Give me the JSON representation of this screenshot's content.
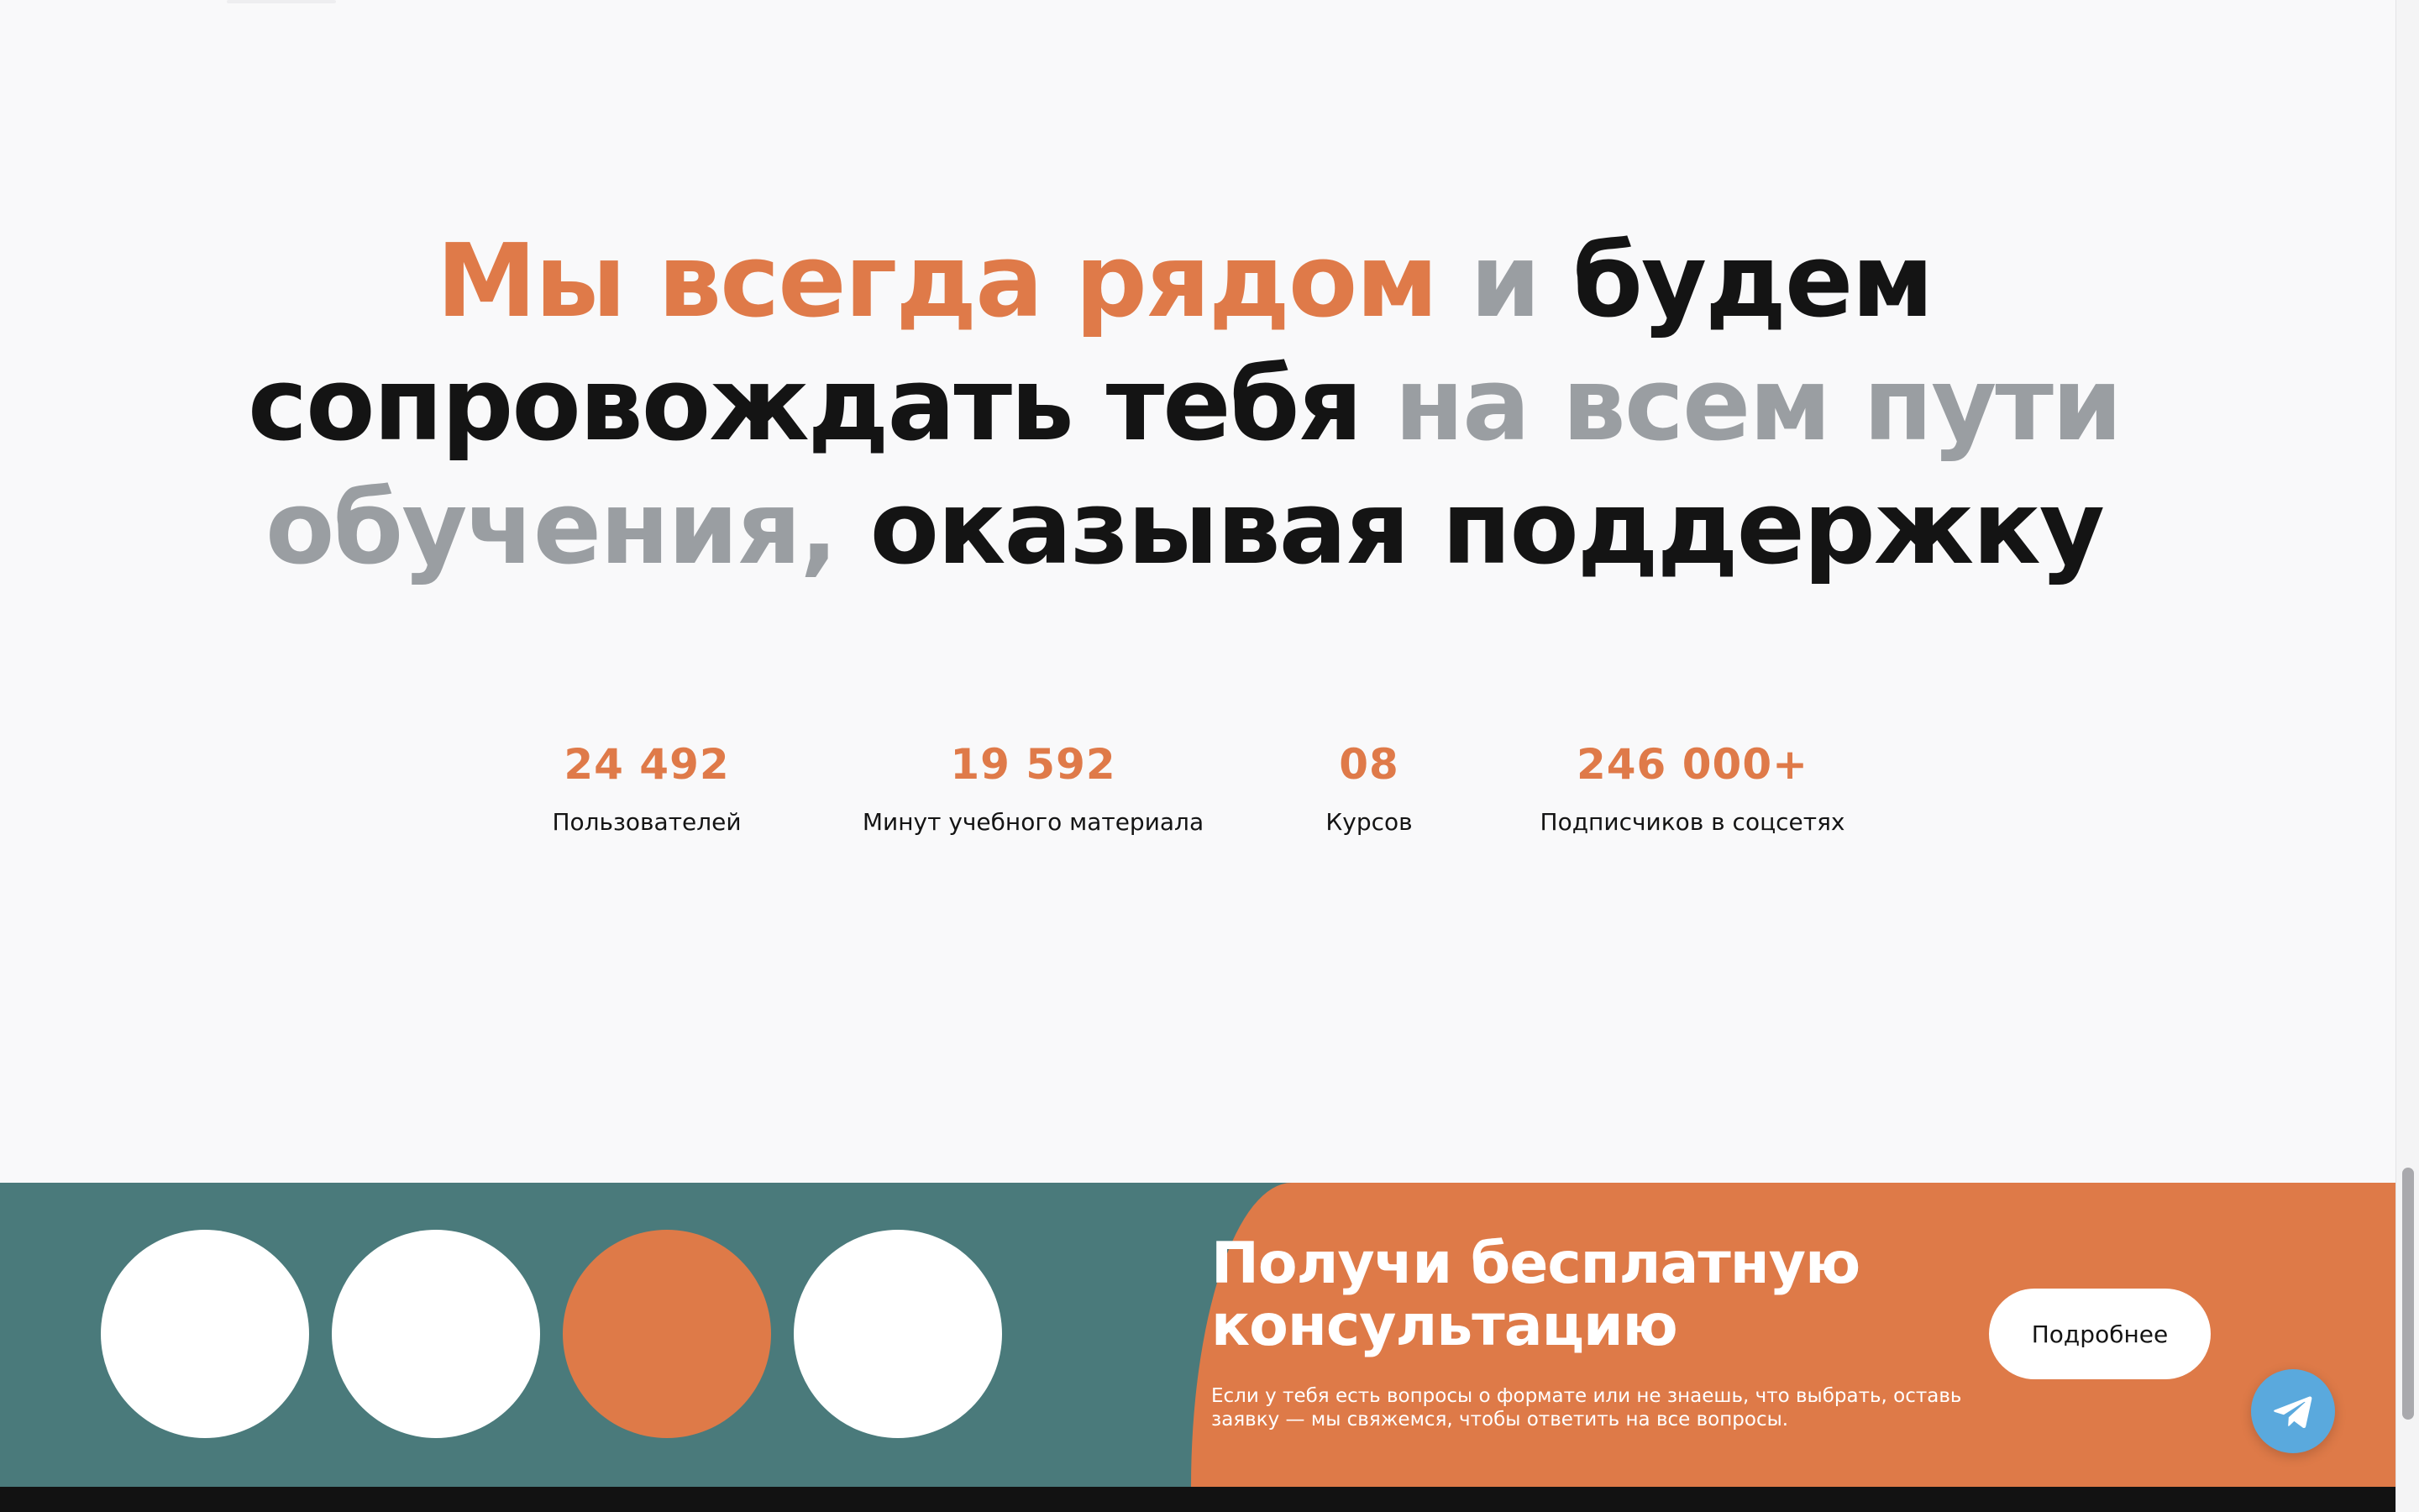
{
  "headline": {
    "line1": [
      {
        "text": "Мы всегда рядом",
        "color": "orange"
      },
      {
        "text": " и ",
        "color": "grey"
      },
      {
        "text": "будем",
        "color": "black"
      }
    ],
    "line2": [
      {
        "text": "сопровождать тебя ",
        "color": "black"
      },
      {
        "text": "на всем пути",
        "color": "grey"
      }
    ],
    "line3": [
      {
        "text": "обучения, ",
        "color": "grey"
      },
      {
        "text": "оказывая поддержку",
        "color": "black"
      }
    ]
  },
  "stats": [
    {
      "value": "24 492",
      "label": "Пользователей"
    },
    {
      "value": "19 592",
      "label": "Минут учебного материала"
    },
    {
      "value": "08",
      "label": "Курсов"
    },
    {
      "value": "246 000+",
      "label": "Подписчиков в соцсетях"
    }
  ],
  "cta": {
    "title_line1": "Получи бесплатную",
    "title_line2": "консультацию",
    "text": "Если у тебя есть вопросы о формате или не знаешь, что выбрать, оставь заявку — мы свяжемся, чтобы ответить на все вопросы.",
    "button_label": "Подробнее"
  },
  "floating": {
    "icon": "telegram-icon"
  },
  "colors": {
    "accent": "#df7a49",
    "muted_text": "#9a9ea2",
    "dark_text": "#141414",
    "teal": "#4a7a7b",
    "telegram": "#5aa9dd",
    "background": "#f9f9fa"
  }
}
